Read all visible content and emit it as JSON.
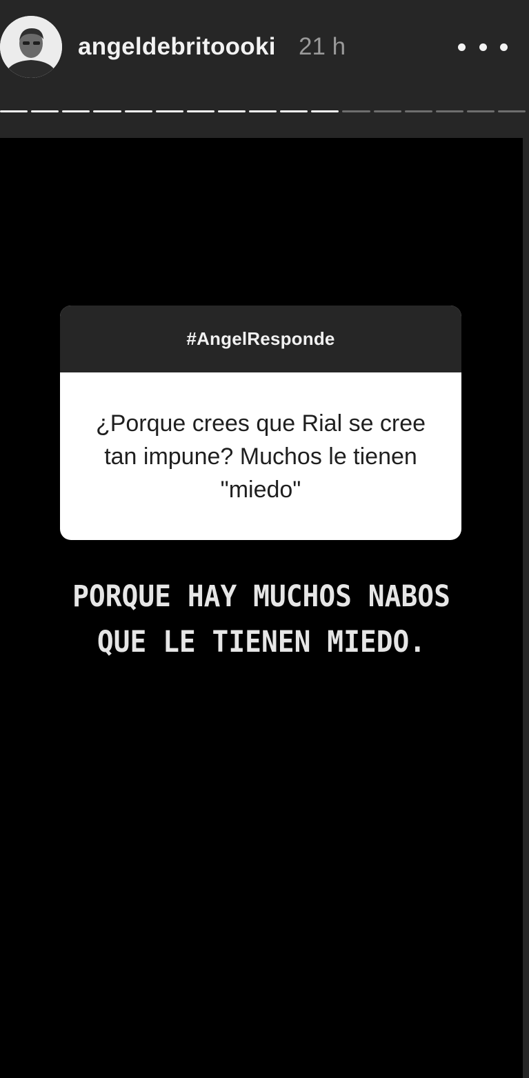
{
  "story": {
    "header": {
      "username": "angeldebritoooki",
      "timestamp": "21 h",
      "more_icon": "more-horizontal-icon",
      "avatar_icon": "user-avatar-icon"
    },
    "progress": {
      "total_segments": 17,
      "viewed_segments": 11
    },
    "question_sticker": {
      "title": "#AngelResponde",
      "question": "¿Porque crees que Rial se cree tan impune? Muchos le tienen \"miedo\""
    },
    "answer": {
      "line1": "PORQUE HAY MUCHOS NABOS",
      "line2": "QUE LE TIENEN MIEDO."
    },
    "colors": {
      "header_bg": "#262626",
      "story_bg": "#000000",
      "card_bg": "#ffffff",
      "text_light": "#f2f2f2",
      "text_muted": "#9a9a9a"
    }
  }
}
